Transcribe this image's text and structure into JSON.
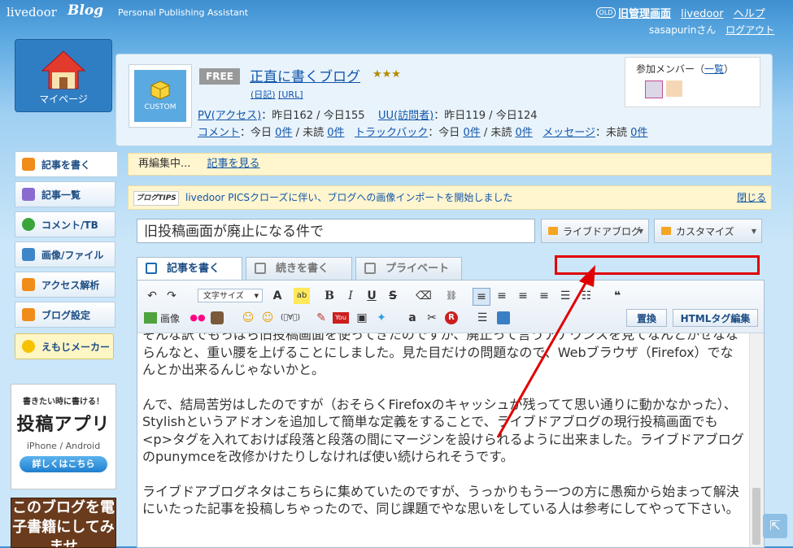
{
  "header": {
    "logo_text": "livedoor",
    "logo_blog": "Blog",
    "tagline": "Personal Publishing Assistant",
    "old_badge": "OLD",
    "links": [
      "旧管理画面",
      "livedoor",
      "ヘルプ"
    ],
    "user_name": "sasapurinさん",
    "logout": "ログアウト"
  },
  "sidebar": {
    "mypage_label": "マイページ",
    "items": [
      {
        "label": "記事を書く",
        "icon": "pencil-icon",
        "color": "#f08c1a"
      },
      {
        "label": "記事一覧",
        "icon": "list-icon",
        "color": "#8a6cd0"
      },
      {
        "label": "コメント/TB",
        "icon": "speech-bubble-icon",
        "color": "#3aa53a"
      },
      {
        "label": "画像/ファイル",
        "icon": "image-icon",
        "color": "#3f86c8"
      },
      {
        "label": "アクセス解析",
        "icon": "bar-chart-icon",
        "color": "#f08c1a"
      },
      {
        "label": "ブログ設定",
        "icon": "wrench-icon",
        "color": "#f08c1a"
      }
    ],
    "emoji_maker": "えもじメーカー",
    "app_ad": {
      "line1": "書きたい時に書ける！",
      "line2": "投稿アプリ",
      "line3": "iPhone / Android",
      "button": "詳しくはこちら"
    },
    "ebook_ad": "このブログを電子書籍にしてみませ"
  },
  "blog": {
    "custom_label": "CUSTOM",
    "free_badge": "FREE",
    "title": "正直に書くブログ",
    "stars": "★★★",
    "sub_link1": "(日記)",
    "sub_link2": "[URL]",
    "stats1": {
      "pv_label": "PV(アクセス)",
      "pv_text": "：昨日162 / 今日155",
      "uu_label": "UU(訪問者)",
      "uu_text": "：昨日119 / 今日124"
    },
    "stats2": {
      "comment_label": "コメント",
      "comment_text": "：今日",
      "comment_today": "0件",
      "comment_unread_label": "/ 未読",
      "comment_unread": "0件",
      "tb_label": "トラックバック",
      "tb_text": "：今日",
      "tb_today": "0件",
      "tb_unread_label": "/ 未読",
      "tb_unread": "0件",
      "msg_label": "メッセージ",
      "msg_text": "：未読",
      "msg_unread": "0件"
    },
    "members": {
      "title_prefix": "参加メンバー（",
      "title_link": "一覧",
      "title_suffix": "）"
    }
  },
  "notice": {
    "text": "再編集中...",
    "link": "記事を見る"
  },
  "tips": {
    "badge": "ブログTIPS",
    "text": "livedoor PICSクローズに伴い、ブログへの画像インポートを開始しました",
    "close": "閉じる"
  },
  "editor": {
    "title_value": "旧投稿画面が廃止になる件で",
    "category1": "ライブドアブログ",
    "category2": "カスタマイズ",
    "tabs": [
      "記事を書く",
      "続きを書く",
      "プライベート"
    ],
    "font_size_select": "文字サイズ",
    "replace_button": "置換",
    "html_button": "HTMLタグ編集",
    "image_label": "画像",
    "paragraphs": [
      "そんな訳でもっぱら旧投稿画面を使ってきたのですが、廃止って言うアナウンスを見てなんとかせなならんなと、重い腰を上げることにしました。見た目だけの問題なので、Webブラウザ（Firefox）でなんとか出来るんじゃないかと。",
      "んで、結局苦労はしたのですが（おそらくFirefoxのキャッシュが残ってて思い通りに動かなかった）、Stylishというアドオンを追加して簡単な定義をすることで、ライブドアブログの現行投稿画面でも<p>タグを入れておけば段落と段落の間にマージンを設けられるように出来ました。ライブドアブログのpunymceを改修かけたりしなければ使い続けられそうです。",
      "ライブドアブログネタはこちらに集めていたのですが、うっかりもう一つの方に愚痴から始まって解決にいたった記事を投稿しちゃったので、同じ課題でやな思いをしている人は参考にしてやって下さい。"
    ]
  },
  "colors": {
    "accent_blue": "#1155aa",
    "annotation_red": "#e00000",
    "notice_bg": "#fff5cf"
  }
}
